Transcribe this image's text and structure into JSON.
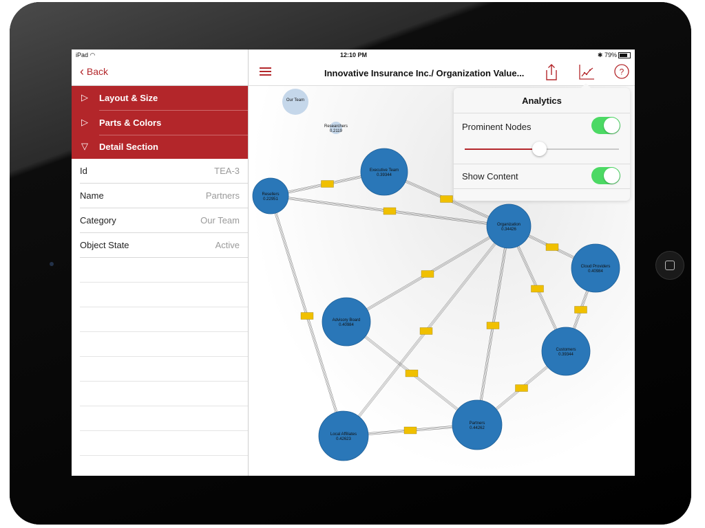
{
  "status_bar": {
    "device": "iPad",
    "time": "12:10 PM",
    "battery": "79%"
  },
  "left_panel": {
    "back_label": "Back",
    "menu": [
      {
        "label": "Layout & Size",
        "expanded": false
      },
      {
        "label": "Parts & Colors",
        "expanded": false
      },
      {
        "label": "Detail Section",
        "expanded": true
      }
    ],
    "properties": [
      {
        "key": "Id",
        "value": "TEA-3"
      },
      {
        "key": "Name",
        "value": "Partners"
      },
      {
        "key": "Category",
        "value": "Our Team"
      },
      {
        "key": "Object State",
        "value": "Active"
      }
    ]
  },
  "toolbar": {
    "title": "Innovative Insurance Inc./ Organization Value...",
    "icons": [
      "menu-icon",
      "share-icon",
      "analytics-chart-icon",
      "help-icon"
    ]
  },
  "analytics_popover": {
    "title": "Analytics",
    "prominent_nodes_label": "Prominent Nodes",
    "prominent_nodes_on": true,
    "slider_value": 0.48,
    "show_content_label": "Show Content",
    "show_content_on": true
  },
  "graph": {
    "node_color": "#2a77b8",
    "faded_color": "#c5d7ea",
    "edge_label_color": "#f0c000",
    "nodes": [
      {
        "id": "our_team",
        "name": "Our Team",
        "score": "",
        "faded": true
      },
      {
        "id": "researchers",
        "name": "Researchers",
        "score": "0.2119",
        "faded": true
      },
      {
        "id": "executive_team",
        "name": "Executive Team",
        "score": "0.39344",
        "faded": false
      },
      {
        "id": "resellers",
        "name": "Resellers",
        "score": "0.22951",
        "faded": false
      },
      {
        "id": "organization",
        "name": "Organization",
        "score": "0.34426",
        "faded": false
      },
      {
        "id": "cloud_providers",
        "name": "Cloud Providers",
        "score": "0.40984",
        "faded": false
      },
      {
        "id": "advisory_board",
        "name": "Advisory Board",
        "score": "0.40984",
        "faded": false
      },
      {
        "id": "customers",
        "name": "Customers",
        "score": "0.39344",
        "faded": false
      },
      {
        "id": "local_affiliates",
        "name": "Local Affiliates",
        "score": "0.42623",
        "faded": false
      },
      {
        "id": "partners",
        "name": "Partners",
        "score": "0.44262",
        "faded": false
      }
    ],
    "edges": [
      [
        "resellers",
        "executive_team"
      ],
      [
        "resellers",
        "organization"
      ],
      [
        "executive_team",
        "organization"
      ],
      [
        "organization",
        "advisory_board"
      ],
      [
        "organization",
        "local_affiliates"
      ],
      [
        "organization",
        "partners"
      ],
      [
        "organization",
        "customers"
      ],
      [
        "organization",
        "cloud_providers"
      ],
      [
        "cloud_providers",
        "customers"
      ],
      [
        "customers",
        "partners"
      ],
      [
        "advisory_board",
        "partners"
      ],
      [
        "partners",
        "local_affiliates"
      ],
      [
        "resellers",
        "local_affiliates"
      ]
    ]
  }
}
